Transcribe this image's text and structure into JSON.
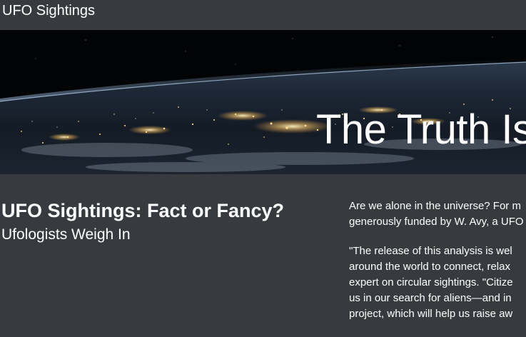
{
  "header": {
    "site_title": "UFO Sightings"
  },
  "hero": {
    "heading": "The Truth Is"
  },
  "article": {
    "title": "UFO Sightings: Fact or Fancy?",
    "subtitle": "Ufologists Weigh In",
    "paragraph_1": [
      "Are we alone in the universe? For m",
      "generously funded by W. Avy, a UFO"
    ],
    "paragraph_2": [
      "\"The release of this analysis is wel",
      "around the world to connect, relax",
      "expert on circular sightings. \"Citize",
      "us in our search for aliens—and in",
      "project, which will help us raise aw"
    ]
  },
  "colors": {
    "background": "#373b40",
    "text": "#ffffff",
    "city_lights": "#ffd98a"
  }
}
